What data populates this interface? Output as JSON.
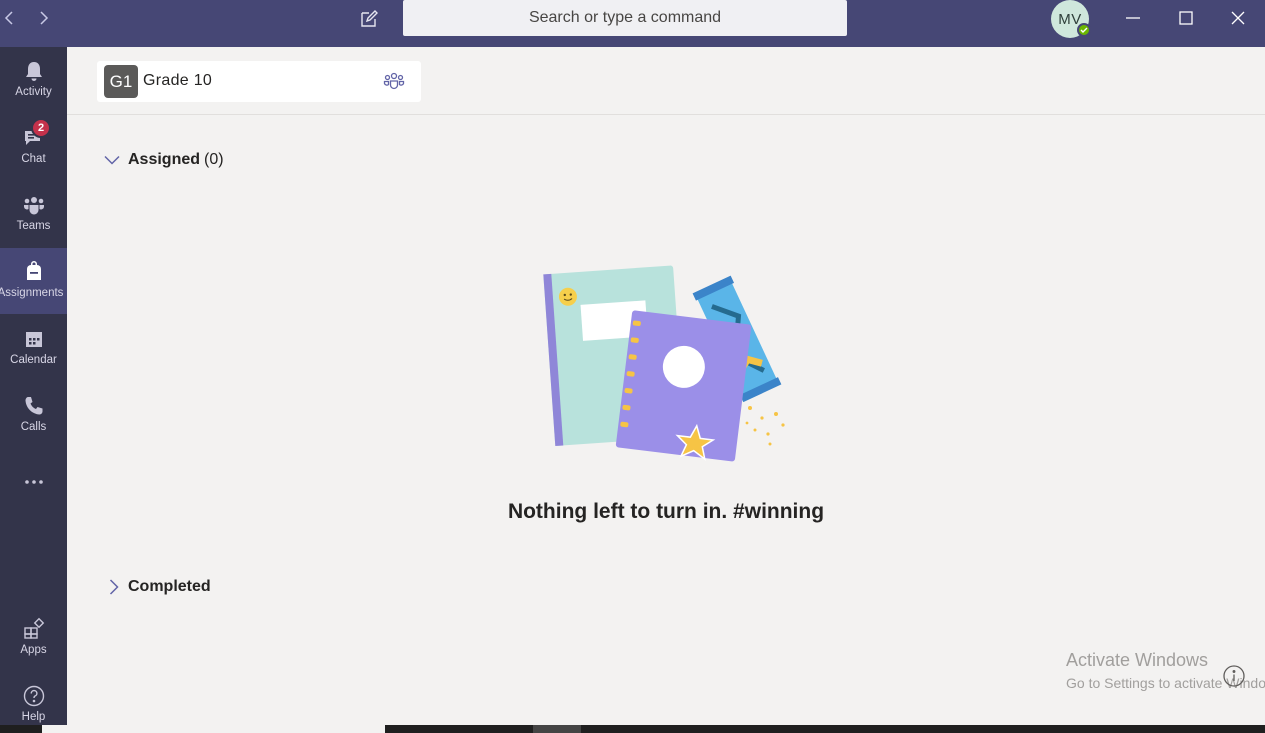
{
  "search": {
    "placeholder": "Search or type a command"
  },
  "user": {
    "initials": "MV",
    "presence": "available"
  },
  "rail": {
    "items": [
      {
        "label": "Activity",
        "icon": "bell-icon"
      },
      {
        "label": "Chat",
        "icon": "chat-icon",
        "badge": "2"
      },
      {
        "label": "Teams",
        "icon": "teams-icon"
      },
      {
        "label": "Assignments",
        "icon": "backpack-icon",
        "active": true
      },
      {
        "label": "Calendar",
        "icon": "calendar-icon"
      },
      {
        "label": "Calls",
        "icon": "phone-icon"
      },
      {
        "label": "",
        "icon": "more-icon"
      },
      {
        "label": "Apps",
        "icon": "apps-icon"
      },
      {
        "label": "Help",
        "icon": "help-icon"
      }
    ]
  },
  "class": {
    "avatar": "G1",
    "name": "Grade 10"
  },
  "assigned": {
    "title": "Assigned",
    "count": "(0)"
  },
  "empty": {
    "message": "Nothing left to turn in. #winning"
  },
  "completed": {
    "title": "Completed"
  },
  "watermark": {
    "line1": "Activate Windows",
    "line2": "Go to Settings to activate Windows."
  },
  "colors": {
    "titlebar": "#464775",
    "rail": "#33344a",
    "accent": "#6264a7",
    "badge": "#c4314b"
  }
}
